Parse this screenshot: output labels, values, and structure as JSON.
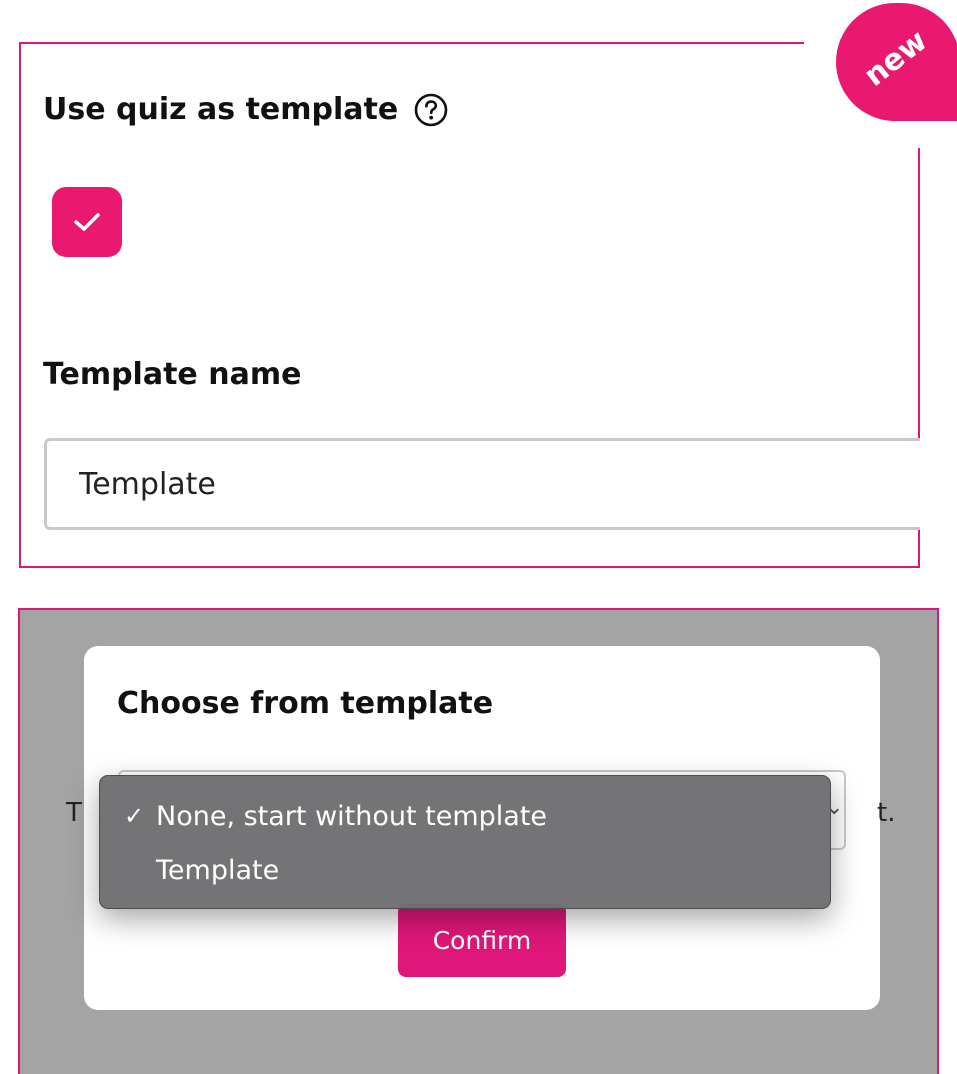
{
  "badge": {
    "label": "new"
  },
  "quiz_template": {
    "heading": "Use quiz as template",
    "help_icon": "question-circle-icon",
    "checkbox_checked": true,
    "checkbox_icon": "checkmark-icon"
  },
  "template_name": {
    "heading": "Template name",
    "value": "Template"
  },
  "modal": {
    "title": "Choose from template",
    "background_text_left": "T",
    "background_text_right": "t.",
    "select_chevron_icon": "chevron-down-icon",
    "dropdown": {
      "options": [
        {
          "label": "None, start without template",
          "selected": true,
          "check": "✓"
        },
        {
          "label": "Template",
          "selected": false
        }
      ]
    },
    "confirm_label": "Confirm"
  },
  "colors": {
    "accent": "#e8196e",
    "border": "#e0157a",
    "overlay": "#a4a4a4",
    "dropdown": "#707072"
  }
}
